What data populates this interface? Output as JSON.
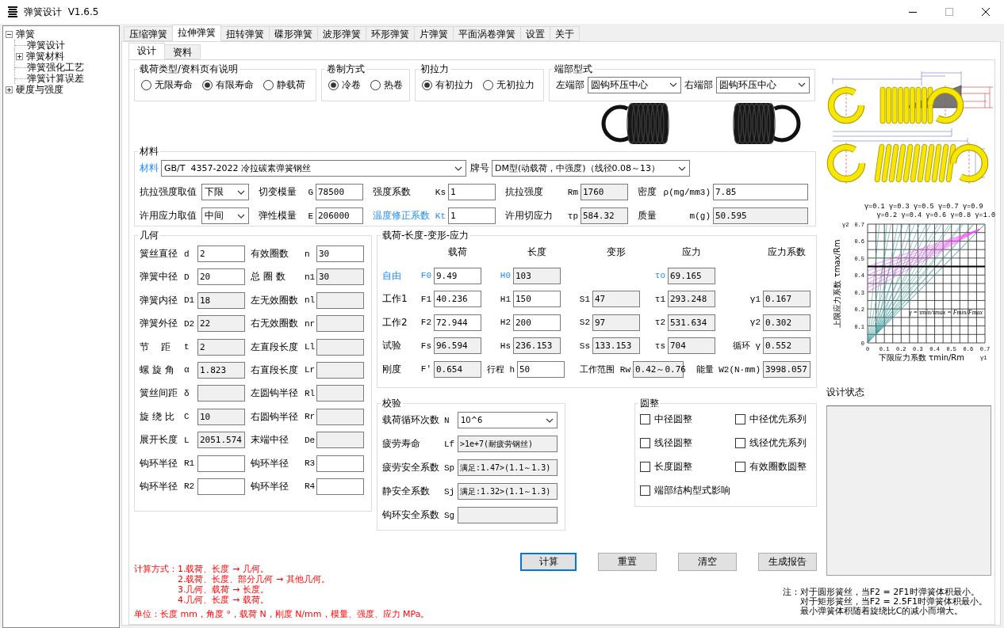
{
  "window": {
    "title": "弹簧设计  V1.6.5"
  },
  "tree": [
    {
      "label": "弹簧",
      "expanded": true,
      "children": [
        {
          "label": "弹簧设计"
        },
        {
          "label": "弹簧材料",
          "expanded": false
        },
        {
          "label": "弹簧强化工艺"
        },
        {
          "label": "弹簧计算误差"
        }
      ]
    },
    {
      "label": "硬度与强度",
      "expanded": false
    }
  ],
  "tabs": [
    {
      "label": "压缩弹簧",
      "selected": false
    },
    {
      "label": "拉伸弹簧",
      "selected": true
    },
    {
      "label": "扭转弹簧",
      "selected": false
    },
    {
      "label": "碟形弹簧",
      "selected": false
    },
    {
      "label": "波形弹簧",
      "selected": false
    },
    {
      "label": "环形弹簧",
      "selected": false
    },
    {
      "label": "片弹簧",
      "selected": false
    },
    {
      "label": "平面涡卷弹簧",
      "selected": false
    },
    {
      "label": "设置",
      "selected": false
    },
    {
      "label": "关于",
      "selected": false
    }
  ],
  "subtabs": [
    {
      "label": "设计",
      "selected": true
    },
    {
      "label": "资料",
      "selected": false
    }
  ],
  "load_type": {
    "title": "载荷类型/资料页有说明",
    "options": [
      {
        "label": "无限寿命",
        "selected": false
      },
      {
        "label": "有限寿命",
        "selected": true
      },
      {
        "label": "静载荷",
        "selected": false
      }
    ]
  },
  "coiling": {
    "title": "卷制方式",
    "options": [
      {
        "label": "冷卷",
        "selected": true
      },
      {
        "label": "热卷",
        "selected": false
      }
    ]
  },
  "initial_tension": {
    "title": "初拉力",
    "options": [
      {
        "label": "有初拉力",
        "selected": true
      },
      {
        "label": "无初拉力",
        "selected": false
      }
    ]
  },
  "end_type": {
    "title": "端部型式",
    "left": {
      "label": "左端部",
      "value": "圆钩环压中心"
    },
    "right": {
      "label": "右端部",
      "value": "圆钩环压中心"
    }
  },
  "material": {
    "title": "材料",
    "material": {
      "label": "材料",
      "emphasis": true,
      "value": "GB/T  4357-2022 冷拉碳素弹簧钢丝"
    },
    "grade": {
      "label": "牌号",
      "value": "DM型(动载荷，中强度)（线径0.08～13）"
    },
    "rows": [
      [
        {
          "label": "抗拉强度取值",
          "kind": "select",
          "value": "下限"
        },
        {
          "label": "切变模量",
          "symbol": "G",
          "kind": "input",
          "value": "78500"
        },
        {
          "label": "强度系数",
          "symbol": "Ks",
          "kind": "input",
          "value": "1"
        },
        {
          "label": "抗拉强度",
          "symbol": "Rm",
          "kind": "readonly",
          "value": "1760"
        },
        {
          "label": "密度",
          "symbol": "ρ(mg/mm3)",
          "kind": "input",
          "value": "7.85"
        }
      ],
      [
        {
          "label": "许用应力取值",
          "kind": "select",
          "value": "中间"
        },
        {
          "label": "弹性模量",
          "symbol": "E",
          "kind": "input",
          "value": "206000"
        },
        {
          "label": "温度修正系数",
          "symbol": "Kt",
          "kind": "input",
          "value": "1",
          "emphasis": true
        },
        {
          "label": "许用切应力",
          "symbol": "τp",
          "kind": "readonly",
          "value": "584.32"
        },
        {
          "label": "质量",
          "symbol": "m(g)",
          "kind": "readonly",
          "value": "50.595"
        }
      ]
    ]
  },
  "geometry": {
    "title": "几何",
    "rows": [
      [
        {
          "label": "簧丝直径",
          "symbol": "d",
          "kind": "input",
          "value": "2"
        },
        {
          "label": "有效圈数",
          "symbol": "n",
          "kind": "input",
          "value": "30"
        }
      ],
      [
        {
          "label": "弹簧中径",
          "symbol": "D",
          "kind": "input",
          "value": "20"
        },
        {
          "label": "总 圈 数",
          "symbol": "n1",
          "kind": "readonly",
          "value": "30"
        }
      ],
      [
        {
          "label": "弹簧内径",
          "symbol": "D1",
          "kind": "readonly",
          "value": "18"
        },
        {
          "label": "左无效圈数",
          "symbol": "nl",
          "kind": "readonly"
        }
      ],
      [
        {
          "label": "弹簧外径",
          "symbol": "D2",
          "kind": "readonly",
          "value": "22"
        },
        {
          "label": "右无效圈数",
          "symbol": "nr",
          "kind": "readonly"
        }
      ],
      [
        {
          "label": "节    距",
          "symbol": "t",
          "kind": "readonly",
          "value": "2"
        },
        {
          "label": "左直段长度",
          "symbol": "Ll",
          "kind": "readonly"
        }
      ],
      [
        {
          "label": "螺 旋 角",
          "symbol": "α",
          "kind": "readonly",
          "value": "1.823"
        },
        {
          "label": "右直段长度",
          "symbol": "Lr",
          "kind": "readonly"
        }
      ],
      [
        {
          "label": "簧丝间距",
          "symbol": "δ",
          "kind": "readonly"
        },
        {
          "label": "左圆钩半径",
          "symbol": "Rl",
          "kind": "readonly"
        }
      ],
      [
        {
          "label": "旋 绕 比",
          "symbol": "C",
          "kind": "readonly",
          "value": "10"
        },
        {
          "label": "右圆钩半径",
          "symbol": "Rr",
          "kind": "readonly"
        }
      ],
      [
        {
          "label": "展开长度",
          "symbol": "L",
          "kind": "readonly",
          "value": "2051.574"
        },
        {
          "label": "末端中径",
          "symbol": "De",
          "kind": "readonly"
        }
      ],
      [
        {
          "label": "钩环半径",
          "symbol": "R1",
          "kind": "input"
        },
        {
          "label": "钩环半径",
          "symbol": "R3",
          "kind": "input"
        }
      ],
      [
        {
          "label": "钩环半径",
          "symbol": "R2",
          "kind": "input"
        },
        {
          "label": "钩环半径",
          "symbol": "R4",
          "kind": "input"
        }
      ]
    ]
  },
  "load": {
    "title": "载荷-长度-变形-应力",
    "headers": [
      "载荷",
      "长度",
      "变形",
      "应力",
      "应力系数"
    ],
    "rows": [
      {
        "label": "自由",
        "emphasis": true,
        "kind": "standard",
        "cells": [
          {
            "symbol": "F0",
            "kind": "input",
            "value": "9.49"
          },
          {
            "symbol": "H0",
            "kind": "readonly",
            "value": "103"
          },
          {
            "kind": "blank"
          },
          {
            "symbol": "τo",
            "kind": "readonly",
            "value": "69.165"
          },
          {
            "kind": "blank"
          }
        ]
      },
      {
        "label": "工作1",
        "kind": "standard",
        "cells": [
          {
            "symbol": "F1",
            "kind": "input",
            "value": "40.236"
          },
          {
            "symbol": "H1",
            "kind": "input",
            "value": "150"
          },
          {
            "symbol": "S1",
            "kind": "readonly",
            "value": "47"
          },
          {
            "symbol": "τ1",
            "kind": "readonly",
            "value": "293.248"
          },
          {
            "symbol": "γ1",
            "kind": "readonly",
            "value": "0.167"
          }
        ]
      },
      {
        "label": "工作2",
        "kind": "standard",
        "cells": [
          {
            "symbol": "F2",
            "kind": "input",
            "value": "72.944"
          },
          {
            "symbol": "H2",
            "kind": "input",
            "value": "200"
          },
          {
            "symbol": "S2",
            "kind": "readonly",
            "value": "97"
          },
          {
            "symbol": "τ2",
            "kind": "readonly",
            "value": "531.634"
          },
          {
            "symbol": "γ2",
            "kind": "readonly",
            "value": "0.302"
          }
        ]
      },
      {
        "label": "试验",
        "kind": "standard",
        "cells": [
          {
            "symbol": "Fs",
            "kind": "readonly",
            "value": "96.594"
          },
          {
            "symbol": "Hs",
            "kind": "readonly",
            "value": "236.153"
          },
          {
            "symbol": "Ss",
            "kind": "readonly",
            "value": "133.153"
          },
          {
            "symbol": "τs",
            "kind": "readonly",
            "value": "704"
          },
          {
            "symbol": "循环 γ",
            "kind": "readonly",
            "value": "0.552"
          }
        ]
      },
      {
        "label": "刚度",
        "kind": "summary",
        "cells": [
          {
            "symbol": "F′",
            "kind": "readonly",
            "value": "0.654"
          },
          {
            "symbol": "行程 h",
            "kind": "input",
            "value": "50"
          },
          {
            "symbol": "工作范围 Rw",
            "kind": "readonly",
            "value": "0.42～0.76"
          },
          {
            "symbol": "能量 W2(N·mm)",
            "kind": "readonly",
            "value": "3998.057"
          }
        ]
      }
    ]
  },
  "check": {
    "title": "校验",
    "rows": [
      {
        "label": "载荷循环次数",
        "symbol": "N",
        "kind": "select",
        "value": "10^6"
      },
      {
        "label": "疲劳寿命",
        "symbol": "Lf",
        "kind": "readonly",
        "value": ">1e+7(耐疲劳钢丝)"
      },
      {
        "label": "疲劳安全系数",
        "symbol": "Sp",
        "kind": "readonly",
        "value": "满足:1.47>(1.1～1.3)"
      },
      {
        "label": "静安全系数",
        "symbol": "Sj",
        "kind": "readonly",
        "value": "满足:1.32>(1.1～1.3)"
      },
      {
        "label": "钩环安全系数",
        "symbol": "Sg",
        "kind": "readonly"
      }
    ]
  },
  "rounding": {
    "title": "圆整",
    "options": [
      {
        "label": "中径圆整",
        "checked": false
      },
      {
        "label": "中径优先系列",
        "checked": false
      },
      {
        "label": "线径圆整",
        "checked": false
      },
      {
        "label": "线径优先系列",
        "checked": false
      },
      {
        "label": "长度圆整",
        "checked": false
      },
      {
        "label": "有效圈数圆整",
        "checked": false
      },
      {
        "label": "端部结构型式影响",
        "checked": false
      }
    ]
  },
  "buttons": [
    {
      "label": "计算",
      "focused": true
    },
    {
      "label": "重置",
      "focused": false
    },
    {
      "label": "清空",
      "focused": false
    },
    {
      "label": "生成报告",
      "focused": false
    }
  ],
  "notes": {
    "method_label": "计算方式：",
    "methods": [
      "1.载荷、长度 → 几何。",
      "2.载荷、长度、部分几何 → 其他几何。",
      "3.几何、载荷 → 长度。",
      "4.几何、长度 → 载荷。"
    ],
    "units": "单位：长度 mm，角度 °，载荷 N，刚度 N/mm，模量、强度、应力 MPa。"
  },
  "remark": {
    "label": "注：",
    "lines": [
      "对于圆形簧丝，当F2 = 2F1时弹簧体积最小。",
      "对于矩形簧丝，当F2 = 2.5F1时弹簧体积最小。",
      "最小弹簧体积随着旋绕比C的减小而增大。"
    ]
  },
  "stress_chart": {
    "gamma_labels": [
      "γ=0.1",
      "γ=0.2",
      "γ=0.3",
      "γ=0.4",
      "γ=0.5",
      "γ=0.6",
      "γ=0.7",
      "γ=0.8",
      "γ=0.9",
      "γ=1.0"
    ],
    "xticks": [
      "0",
      "0.1",
      "0.2",
      "0.3",
      "0.4",
      "0.5",
      "0.6",
      "0.7"
    ],
    "yticks": [
      "0.7",
      "0.6",
      "0.5",
      "0.4",
      "0.3",
      "0.2",
      "0.1",
      "0"
    ],
    "x_end_label": "γ1",
    "y_end_label": "γ2",
    "xlabel": "下限应力系数 τmin/Rm",
    "ylabel": "上限应力系数 τmax/Rm",
    "formula": "γ = τmin/τmax = Fmin/Fmax"
  },
  "status": {
    "label": "设计状态"
  }
}
